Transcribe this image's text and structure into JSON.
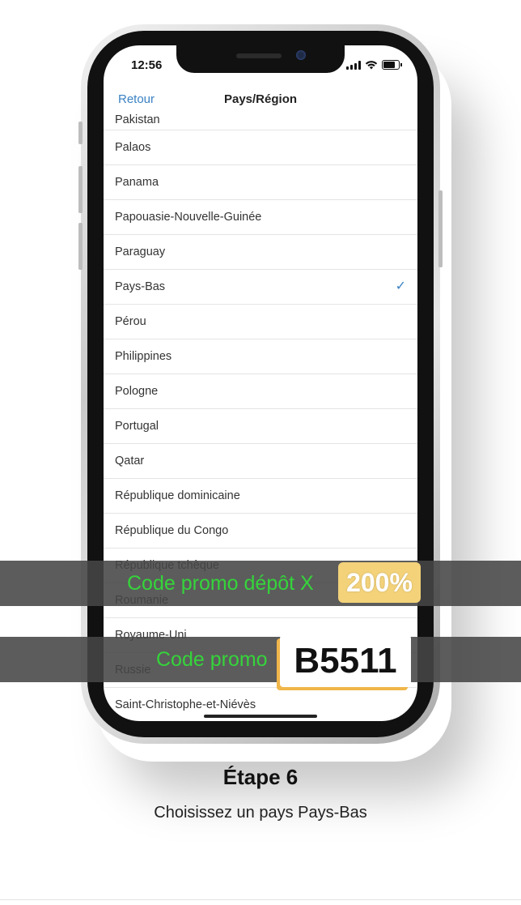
{
  "status_bar": {
    "time": "12:56"
  },
  "nav": {
    "back_label": "Retour",
    "title": "Pays/Région"
  },
  "countries": [
    {
      "name": "Pakistan",
      "selected": false
    },
    {
      "name": "Palaos",
      "selected": false
    },
    {
      "name": "Panama",
      "selected": false
    },
    {
      "name": "Papouasie-Nouvelle-Guinée",
      "selected": false
    },
    {
      "name": "Paraguay",
      "selected": false
    },
    {
      "name": "Pays-Bas",
      "selected": true
    },
    {
      "name": "Pérou",
      "selected": false
    },
    {
      "name": "Philippines",
      "selected": false
    },
    {
      "name": "Pologne",
      "selected": false
    },
    {
      "name": "Portugal",
      "selected": false
    },
    {
      "name": "Qatar",
      "selected": false
    },
    {
      "name": "République dominicaine",
      "selected": false
    },
    {
      "name": "République du Congo",
      "selected": false
    },
    {
      "name": "République tchèque",
      "selected": false
    },
    {
      "name": "Roumanie",
      "selected": false
    },
    {
      "name": "Royaume-Uni",
      "selected": false
    },
    {
      "name": "Russie",
      "selected": false
    },
    {
      "name": "Saint-Christophe-et-Niévès",
      "selected": false
    }
  ],
  "check_icon": "checkmark-icon",
  "promo": {
    "line1_text": "Code promo dépôt X",
    "line1_badge": "200%",
    "line2_text": "Code promo",
    "line2_code": "B5511"
  },
  "step": {
    "title": "Étape 6",
    "description": "Choisissez un pays Pays-Bas"
  },
  "colors": {
    "accent": "#3b82c4",
    "promo_green": "#35d43b",
    "badge_yellow": "#f3d27a"
  }
}
